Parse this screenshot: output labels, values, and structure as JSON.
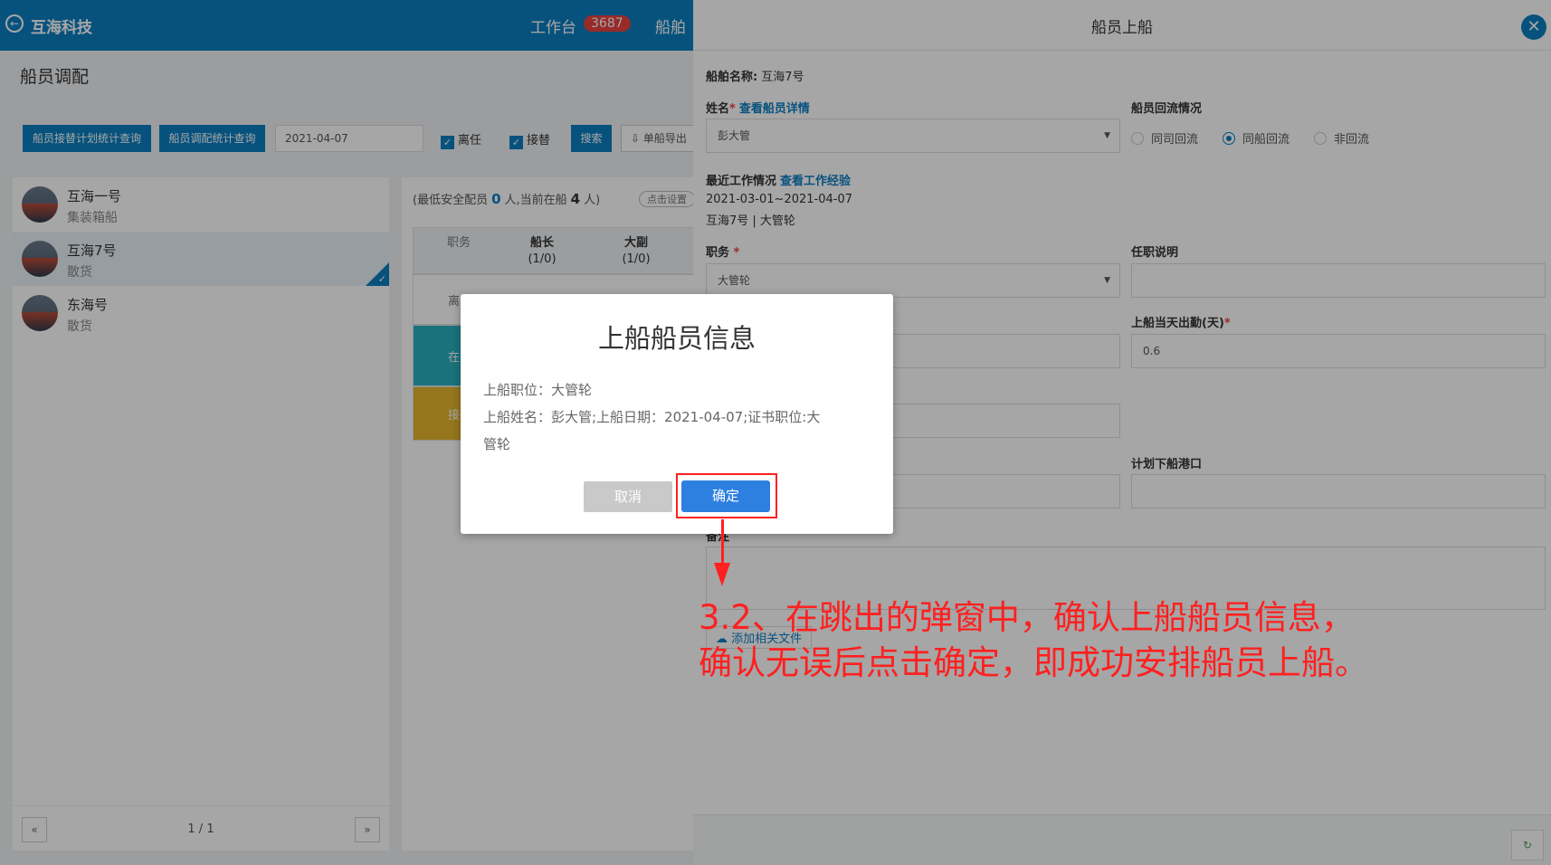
{
  "app": {
    "brand": "互海科技",
    "nav_workbench": "工作台",
    "nav_badge": "3687",
    "nav_ship": "船舶",
    "page_title": "船员调配",
    "toolbar": {
      "btn_plan_stats": "船员接替计划统计查询",
      "btn_dispatch_stats": "船员调配统计查询",
      "date": "2021-04-07",
      "chk_leave": "离任",
      "chk_replace": "接替",
      "btn_search": "搜索",
      "btn_export": "单船导出"
    },
    "ships": [
      {
        "name": "互海一号",
        "type": "集装箱船"
      },
      {
        "name": "互海7号",
        "type": "散货"
      },
      {
        "name": "东海号",
        "type": "散货"
      }
    ],
    "pager": {
      "prev": "«",
      "text": "1 / 1",
      "next": "»"
    },
    "safety": {
      "prefix": "(最低安全配员",
      "min": "0",
      "mid": "人,当前在船",
      "current": "4",
      "suffix": "人)",
      "set_btn": "点击设置"
    },
    "grid_headers": [
      {
        "title": "职务",
        "sub": ""
      },
      {
        "title": "船长",
        "sub": "(1/0)"
      },
      {
        "title": "大副",
        "sub": "(1/0)"
      }
    ],
    "grid_rows": [
      "离",
      "在",
      "接"
    ]
  },
  "drawer": {
    "title": "船员上船",
    "ship_label": "船舶名称:",
    "ship_value": "互海7号",
    "name_label": "姓名",
    "name_link": "查看船员详情",
    "name_value": "彭大管",
    "reflux_label": "船员回流情况",
    "reflux_options": [
      "同司回流",
      "同船回流",
      "非回流"
    ],
    "recent_label": "最近工作情况",
    "recent_link": "查看工作经验",
    "recent_dates": "2021-03-01~2021-04-07",
    "recent_detail": "互海7号 | 大管轮",
    "duty_label": "职务",
    "duty_value": "大管轮",
    "post_desc_label": "任职说明",
    "attendance_label": "上船当天出勤(天)",
    "attendance_value": "0.6",
    "plan_port_label": "计划下船港口",
    "remark_label": "备注",
    "add_file": "添加相关文件"
  },
  "modal": {
    "title": "上船船员信息",
    "line1": "上船职位：大管轮",
    "line2": "上船姓名：彭大管;上船日期：2021-04-07;证书职位:大",
    "line3": "管轮",
    "cancel": "取消",
    "ok": "确定"
  },
  "annotation": {
    "line1": "3.2、在跳出的弹窗中，确认上船船员信息，",
    "line2": "确认无误后点击确定，即成功安排船员上船。",
    "color": "#ff2020"
  }
}
